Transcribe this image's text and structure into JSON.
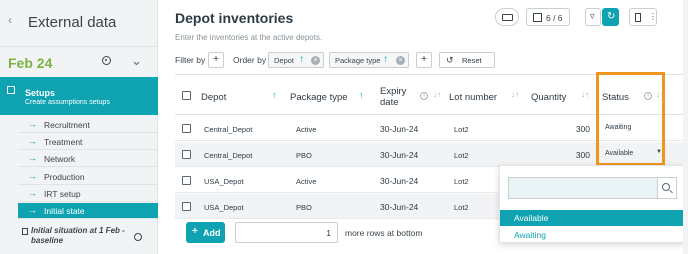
{
  "sidebar": {
    "title": "External data",
    "date": "Feb 24",
    "section": {
      "title": "Setups",
      "subtitle": "Create assumptions setups"
    },
    "items": [
      {
        "label": "Recruitment"
      },
      {
        "label": "Treatment"
      },
      {
        "label": "Network"
      },
      {
        "label": "Production"
      },
      {
        "label": "IRT setup"
      },
      {
        "label": "Initial state"
      }
    ],
    "scenario": "Initial situation at 1 Feb - baseline"
  },
  "header": {
    "title": "Depot inventories",
    "subtitle": "Enter the inventories at the active depots.",
    "columns_count": "6 / 6"
  },
  "filters": {
    "filter_by": "Filter by",
    "order_by": "Order by",
    "chips": [
      {
        "label": "Depot"
      },
      {
        "label": "Package type"
      }
    ],
    "reset": "Reset"
  },
  "table": {
    "columns": [
      "Depot",
      "Package type",
      "Expiry date",
      "Lot number",
      "Quantity",
      "Status"
    ],
    "rows": [
      {
        "depot": "Central_Depot",
        "package": "Active",
        "expiry": "30-Jun-24",
        "lot": "Lot2",
        "qty": "300",
        "status": "Awaiting"
      },
      {
        "depot": "Central_Depot",
        "package": "PBO",
        "expiry": "30-Jun-24",
        "lot": "Lot2",
        "qty": "300",
        "status": "Available"
      },
      {
        "depot": "USA_Depot",
        "package": "Active",
        "expiry": "30-Jun-24",
        "lot": "Lot2",
        "qty": "",
        "status": ""
      },
      {
        "depot": "USA_Depot",
        "package": "PBO",
        "expiry": "30-Jun-24",
        "lot": "Lot2",
        "qty": "",
        "status": ""
      }
    ]
  },
  "footer": {
    "add_label": "Add",
    "rows_value": "1",
    "more_rows": "more rows at bottom"
  },
  "dropdown": {
    "search_value": "",
    "options": [
      "Available",
      "Awaiting"
    ],
    "selected": "Available"
  },
  "colors": {
    "accent": "#0fa3b1",
    "date": "#7cb342",
    "highlight": "#f0961e"
  }
}
